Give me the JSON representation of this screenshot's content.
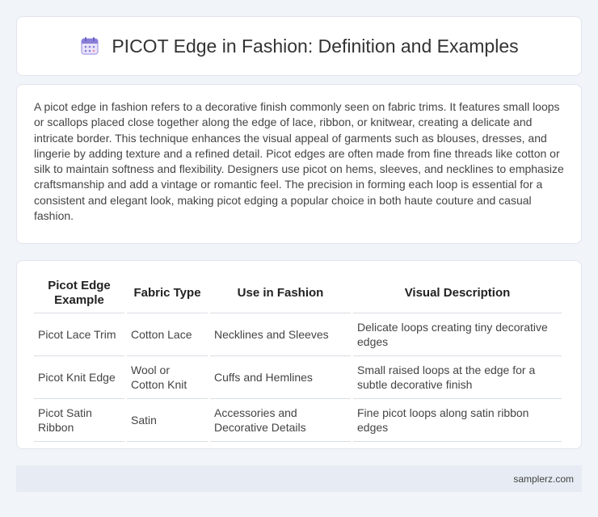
{
  "header": {
    "title": "PICOT Edge in Fashion: Definition and Examples",
    "icon": "calendar-icon"
  },
  "description": {
    "text": "A picot edge in fashion refers to a decorative finish commonly seen on fabric trims. It features small loops or scallops placed close together along the edge of lace, ribbon, or knitwear, creating a delicate and intricate border. This technique enhances the visual appeal of garments such as blouses, dresses, and lingerie by adding texture and a refined detail. Picot edges are often made from fine threads like cotton or silk to maintain softness and flexibility. Designers use picot on hems, sleeves, and necklines to emphasize craftsmanship and add a vintage or romantic feel. The precision in forming each loop is essential for a consistent and elegant look, making picot edging a popular choice in both haute couture and casual fashion."
  },
  "table": {
    "headers": [
      "Picot Edge Example",
      "Fabric Type",
      "Use in Fashion",
      "Visual Description"
    ],
    "rows": [
      [
        "Picot Lace Trim",
        "Cotton Lace",
        "Necklines and Sleeves",
        "Delicate loops creating tiny decorative edges"
      ],
      [
        "Picot Knit Edge",
        "Wool or Cotton Knit",
        "Cuffs and Hemlines",
        "Small raised loops at the edge for a subtle decorative finish"
      ],
      [
        "Picot Satin Ribbon",
        "Satin",
        "Accessories and Decorative Details",
        "Fine picot loops along satin ribbon edges"
      ]
    ]
  },
  "footer": {
    "site": "samplerz.com"
  },
  "colors": {
    "background": "#f1f4f9",
    "card": "#ffffff",
    "footer": "#e6ebf4",
    "icon_accent": "#8a7fd8"
  }
}
